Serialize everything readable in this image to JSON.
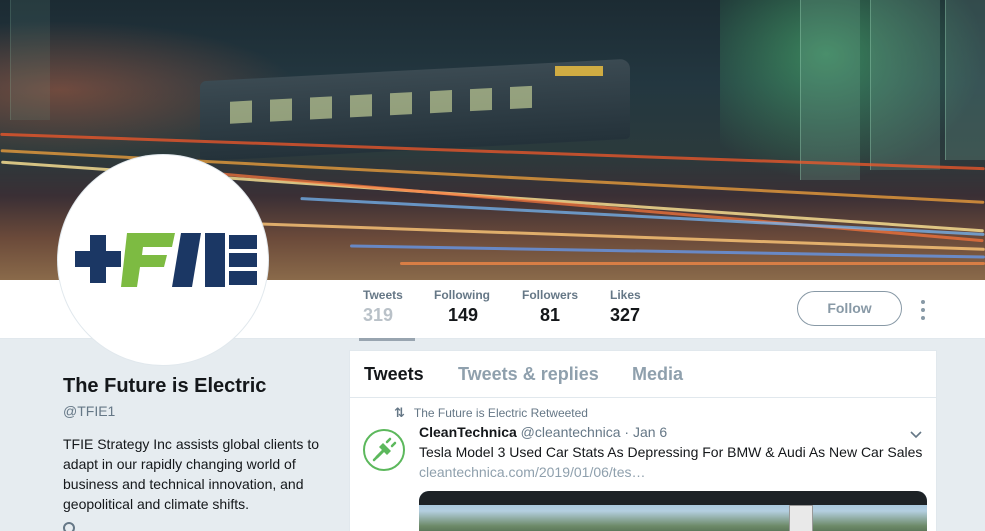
{
  "profile": {
    "name": "The Future is Electric",
    "handle": "@TFIE1",
    "bio": "TFIE Strategy Inc assists global clients to adapt in our rapidly changing world of business and technical innovation, and geopolitical and climate shifts.",
    "logo_colors": {
      "navy": "#1b3764",
      "green": "#7dbb42"
    }
  },
  "stats": [
    {
      "label": "Tweets",
      "value": "319"
    },
    {
      "label": "Following",
      "value": "149"
    },
    {
      "label": "Followers",
      "value": "81"
    },
    {
      "label": "Likes",
      "value": "327"
    }
  ],
  "actions": {
    "follow_label": "Follow",
    "more_icon": "vertical-dots-icon"
  },
  "tabs": [
    {
      "label": "Tweets"
    },
    {
      "label": "Tweets & replies"
    },
    {
      "label": "Media"
    }
  ],
  "tweet": {
    "retweet_context": "The Future is Electric Retweeted",
    "author_name": "CleanTechnica",
    "author_handle": "@cleantechnica",
    "time": "· Jan 6",
    "text": "Tesla Model 3 Used Car Stats As Depressing For BMW & Audi As New Car Sales",
    "link": "cleantechnica.com/2019/01/06/tes…"
  },
  "colors": {
    "accent_muted": "#657786",
    "background": "#e6ecf0",
    "border": "#e1e8ed"
  }
}
